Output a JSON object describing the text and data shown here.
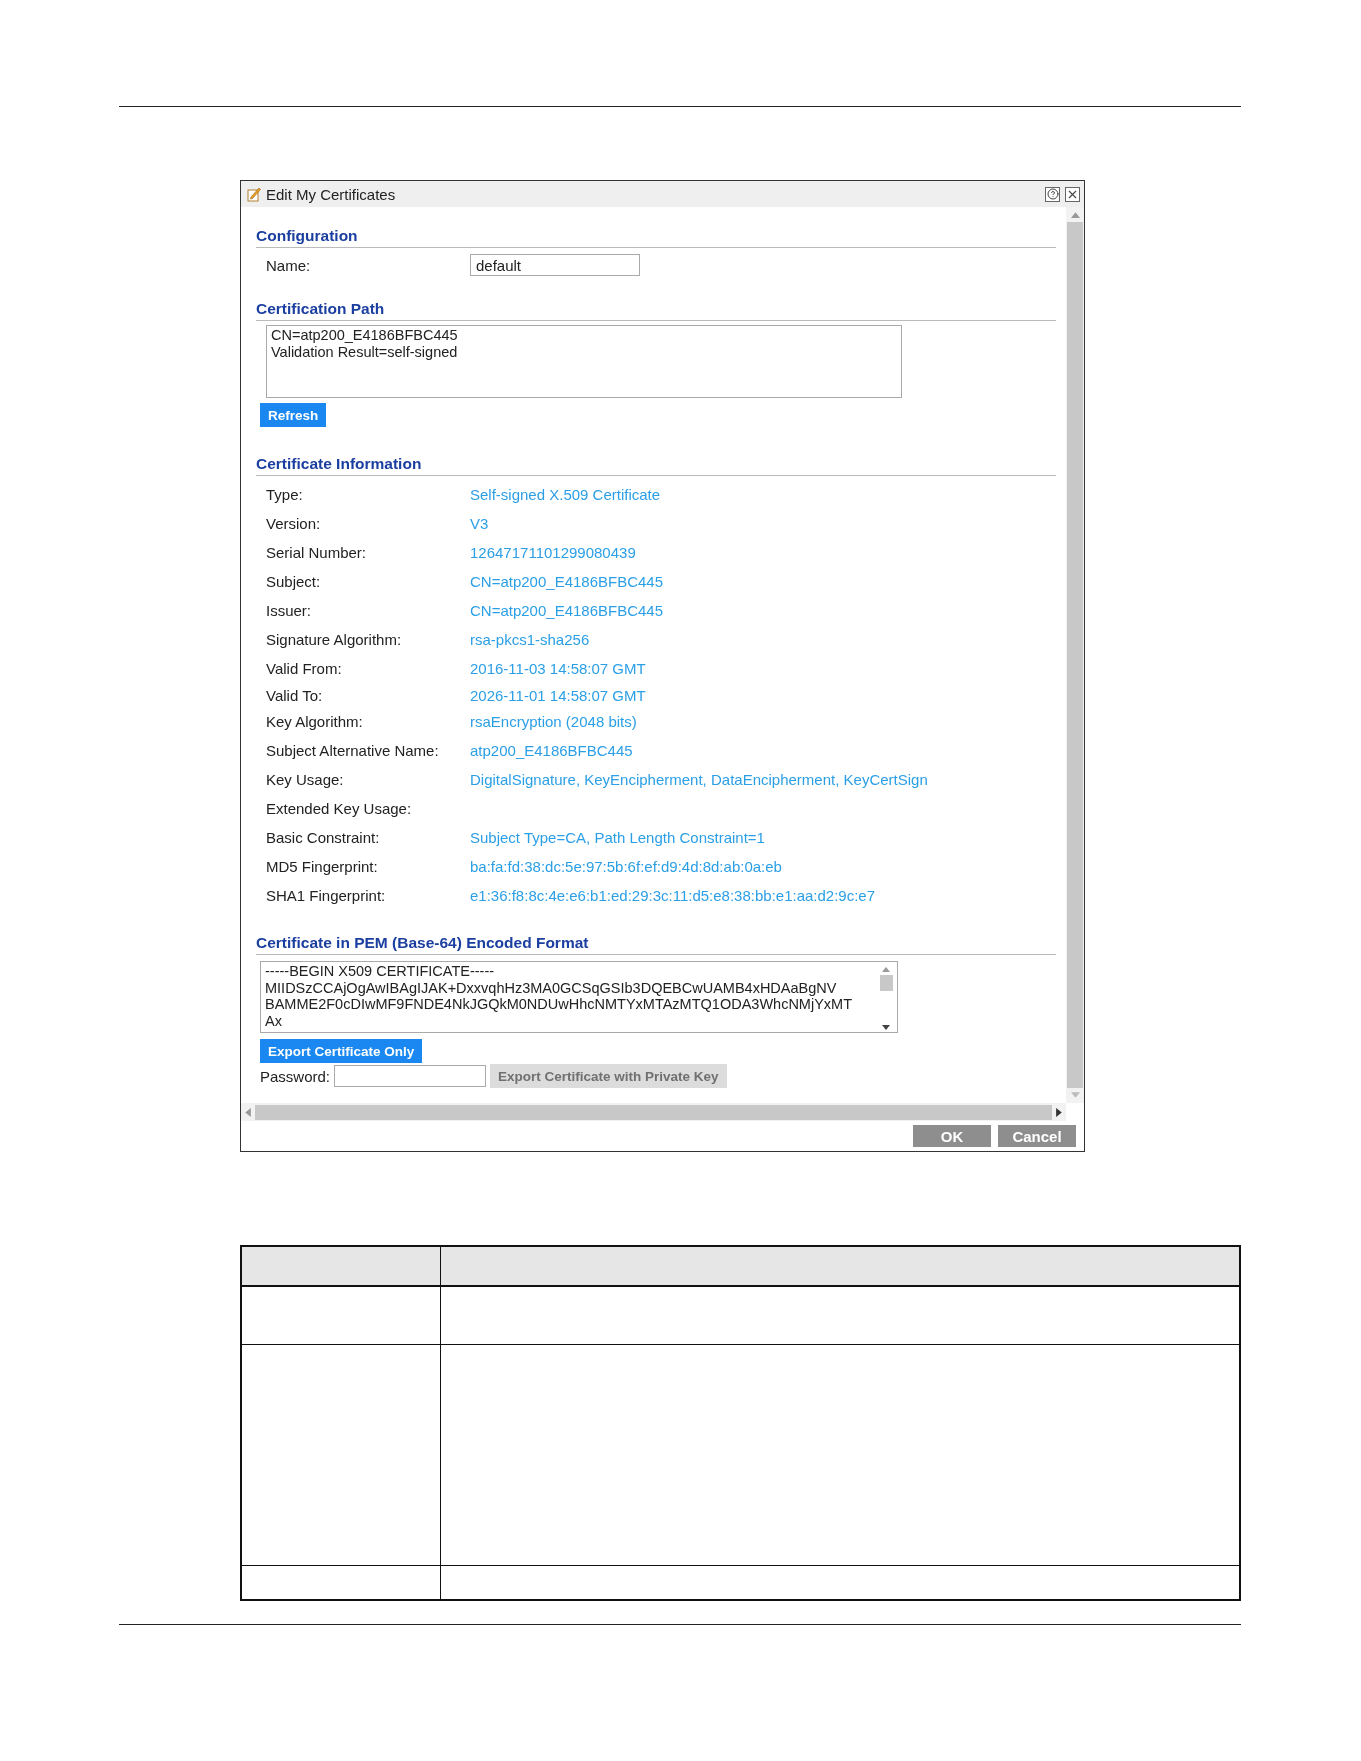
{
  "dialog": {
    "title": "Edit My Certificates",
    "configuration": {
      "heading": "Configuration",
      "name_label": "Name:",
      "name_value": "default"
    },
    "certification_path": {
      "heading": "Certification Path",
      "lines": [
        "CN=atp200_E4186BFBC445",
        "Validation Result=self-signed"
      ],
      "refresh_button": "Refresh"
    },
    "certificate_information": {
      "heading": "Certificate Information",
      "rows": [
        {
          "label": "Type:",
          "value": "Self-signed X.509 Certificate"
        },
        {
          "label": "Version:",
          "value": "V3"
        },
        {
          "label": "Serial Number:",
          "value": "12647171101299080439"
        },
        {
          "label": "Subject:",
          "value": "CN=atp200_E4186BFBC445"
        },
        {
          "label": "Issuer:",
          "value": "CN=atp200_E4186BFBC445"
        },
        {
          "label": "Signature Algorithm:",
          "value": "rsa-pkcs1-sha256"
        },
        {
          "label": "Valid From:",
          "value": "2016-11-03 14:58:07 GMT"
        },
        {
          "label": "Valid To:",
          "value": "2026-11-01 14:58:07 GMT"
        },
        {
          "label": "Key Algorithm:",
          "value": "rsaEncryption (2048 bits)"
        },
        {
          "label": "Subject Alternative Name:",
          "value": "atp200_E4186BFBC445"
        },
        {
          "label": "Key Usage:",
          "value": "DigitalSignature, KeyEncipherment, DataEncipherment, KeyCertSign"
        },
        {
          "label": "Extended Key Usage:"
        },
        {
          "label": "Basic Constraint:",
          "value": "Subject Type=CA, Path Length Constraint=1"
        },
        {
          "label": "MD5 Fingerprint:",
          "value": "ba:fa:fd:38:dc:5e:97:5b:6f:ef:d9:4d:8d:ab:0a:eb"
        },
        {
          "label": "SHA1 Fingerprint:",
          "value": "e1:36:f8:8c:4e:e6:b1:ed:29:3c:11:d5:e8:38:bb:e1:aa:d2:9c:e7"
        }
      ]
    },
    "pem": {
      "heading": "Certificate in PEM (Base-64) Encoded Format",
      "lines": [
        "-----BEGIN X509 CERTIFICATE-----",
        "MIIDSzCCAjOgAwIBAgIJAK+DxxvqhHz3MA0GCSqGSIb3DQEBCwUAMB4xHDAaBgNV",
        "BAMME2F0cDIwMF9FNDE4NkJGQkM0NDUwHhcNMTYxMTAzMTQ1ODA3WhcNMjYxMT",
        "Ax"
      ],
      "export_button": {
        "label": "Export Certificate Only",
        "disabled": false
      },
      "password_label": "Password:",
      "private_key_button": {
        "label": "Export Certificate with Private Key",
        "disabled": true
      }
    },
    "buttons": [
      "OK",
      "Cancel"
    ]
  }
}
